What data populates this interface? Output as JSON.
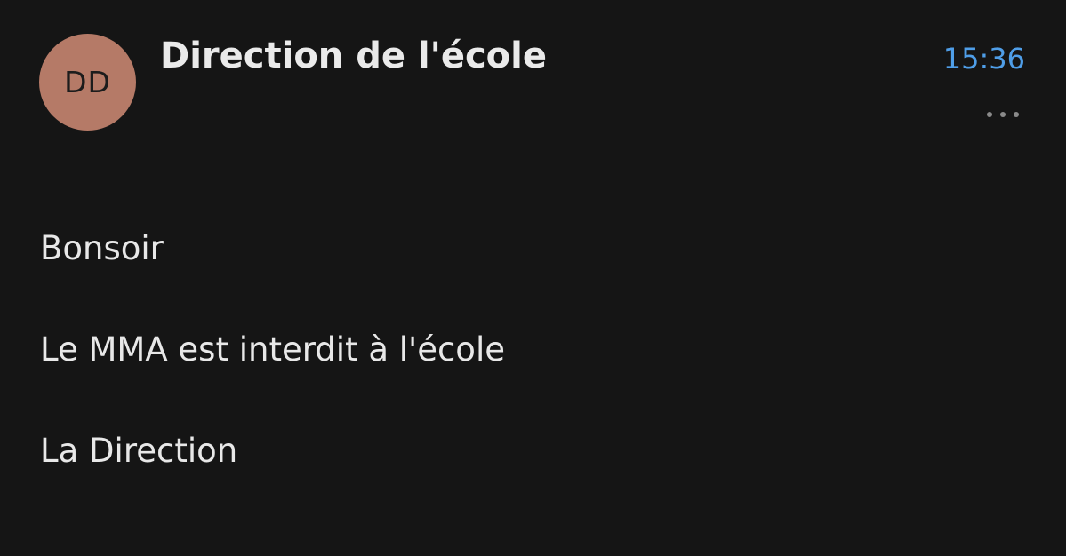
{
  "message": {
    "avatar_initials": "DD",
    "sender": "Direction de l'école",
    "time": "15:36",
    "more_icon": "more-horizontal-icon",
    "body": [
      "Bonsoir",
      "Le MMA est interdit à l'école",
      "La Direction"
    ]
  },
  "colors": {
    "background": "#151515",
    "avatar": "#b57a67",
    "time": "#4f9ee8",
    "text": "#e8e8e8"
  }
}
